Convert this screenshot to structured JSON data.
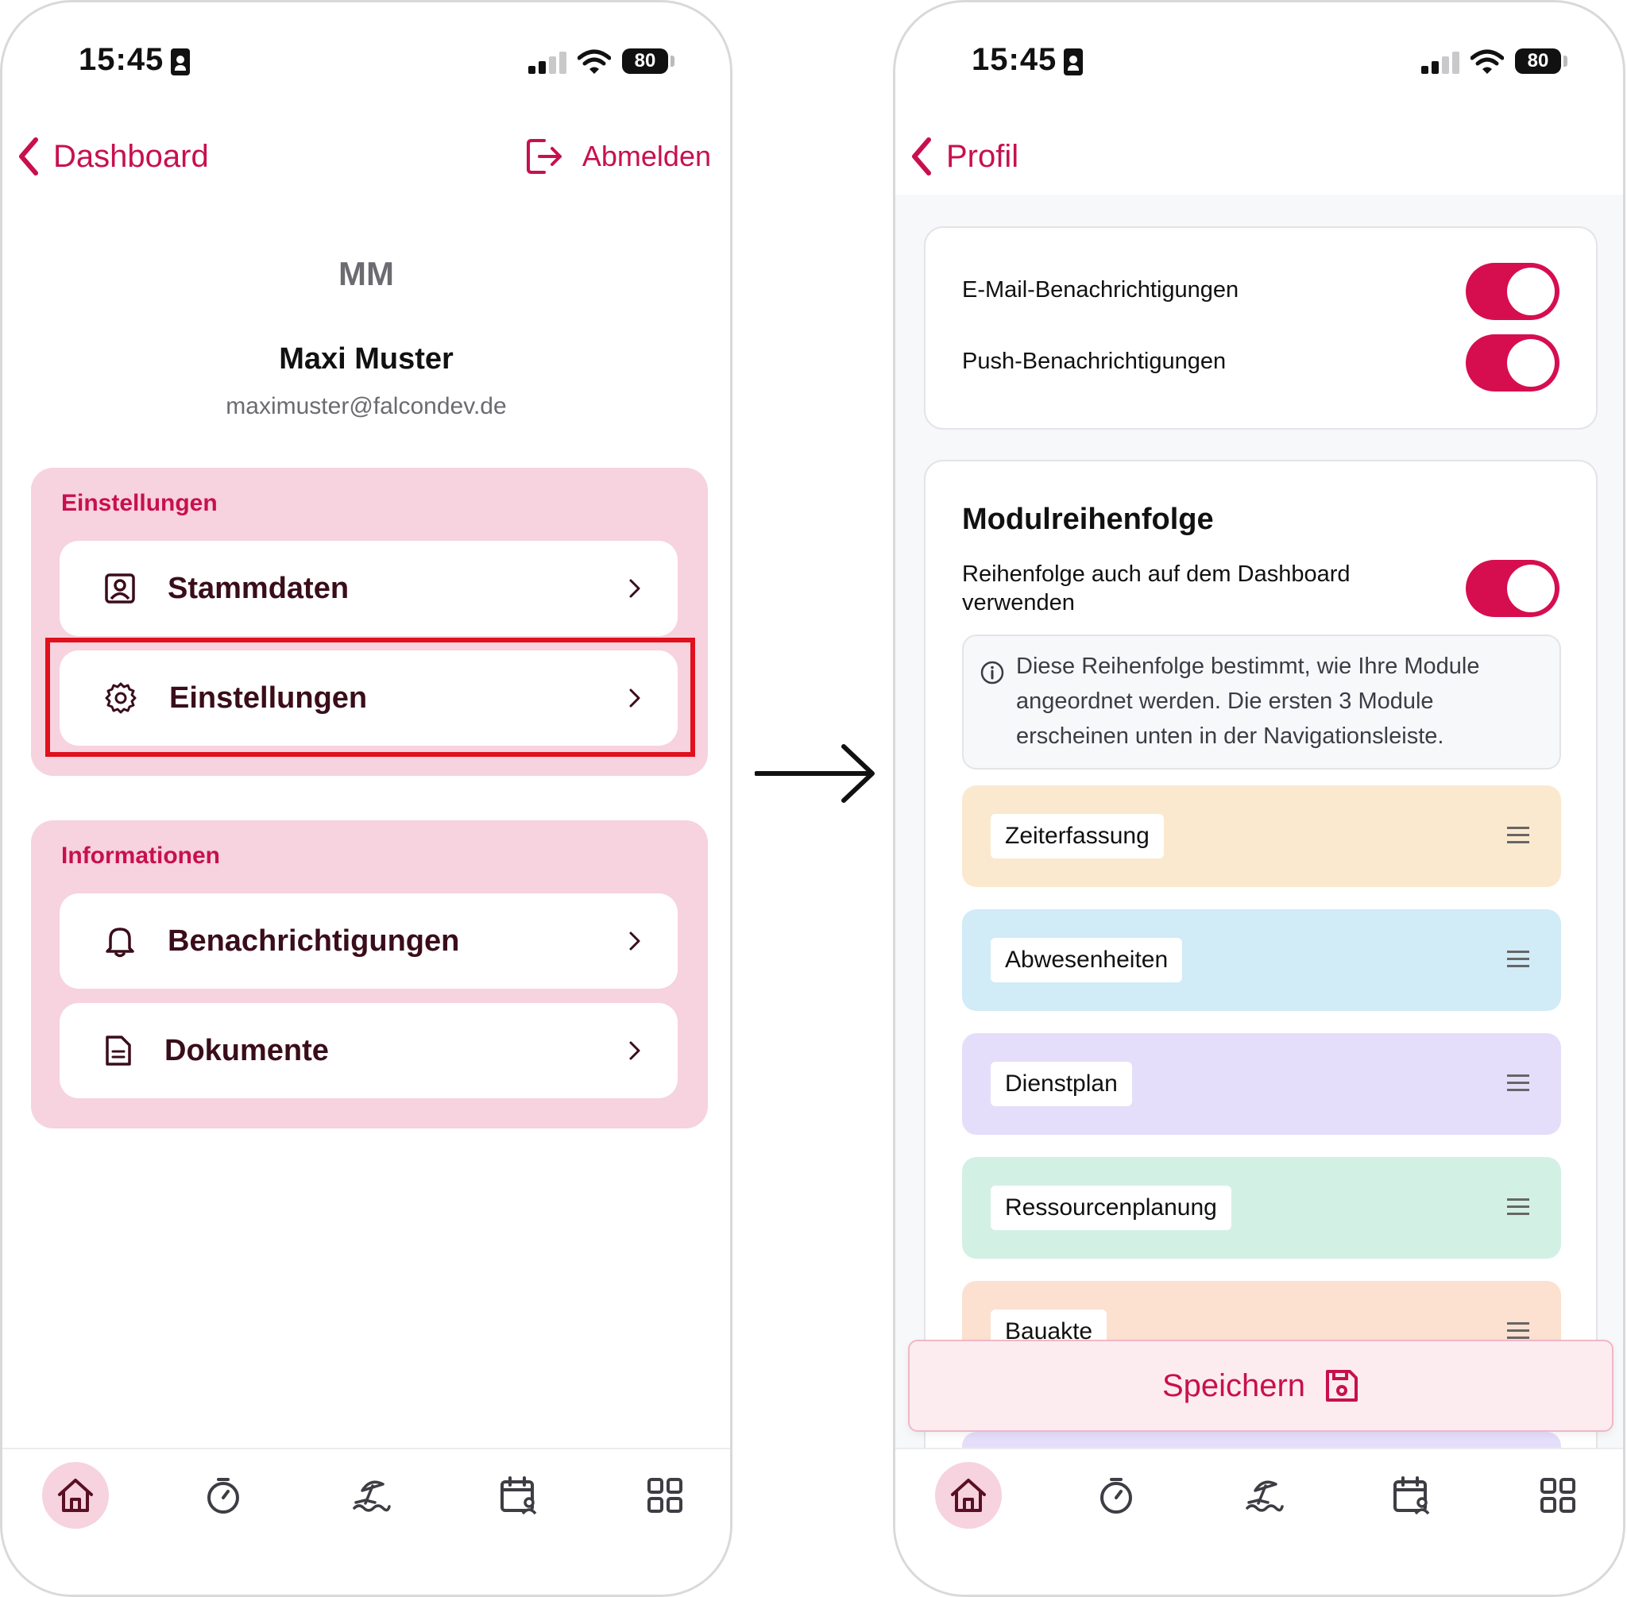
{
  "left": {
    "status": {
      "time": "15:45",
      "battery": "80"
    },
    "back_label": "Dashboard",
    "logout_label": "Abmelden",
    "profile": {
      "initials": "MM",
      "name": "Maxi Muster",
      "email": "maximuster@falcondev.de"
    },
    "settings_group": {
      "title": "Einstellungen",
      "items": [
        {
          "label": "Stammdaten",
          "icon": "contact-card-icon"
        },
        {
          "label": "Einstellungen",
          "icon": "gear-icon"
        }
      ]
    },
    "info_group": {
      "title": "Informationen",
      "items": [
        {
          "label": "Benachrichtigungen",
          "icon": "bell-icon"
        },
        {
          "label": "Dokumente",
          "icon": "document-icon"
        }
      ]
    },
    "tabs": [
      "home-icon",
      "stopwatch-icon",
      "beach-icon",
      "calendar-user-icon",
      "grid-icon"
    ]
  },
  "right": {
    "status": {
      "time": "15:45",
      "battery": "80"
    },
    "back_label": "Profil",
    "notifications": [
      {
        "label": "E-Mail-Benachrichtigungen",
        "on": true
      },
      {
        "label": "Push-Benachrichtigungen",
        "on": true
      }
    ],
    "module_order": {
      "title": "Modulreihenfolge",
      "dashboard_toggle_label": "Reihenfolge auch auf dem Dashboard verwenden",
      "dashboard_toggle_on": true,
      "info": "Diese Reihenfolge bestimmt, wie Ihre Module angeordnet werden. Die ersten 3 Module erscheinen unten in der Navigationsleiste.",
      "modules": [
        {
          "label": "Zeiterfassung",
          "color": "#fbe9cf"
        },
        {
          "label": "Abwesenheiten",
          "color": "#d1ebf7"
        },
        {
          "label": "Dienstplan",
          "color": "#e5defa"
        },
        {
          "label": "Ressourcenplanung",
          "color": "#d3f0e4"
        },
        {
          "label": "Bauakte",
          "color": "#fce0d0"
        }
      ]
    },
    "save_label": "Speichern",
    "tabs": [
      "home-icon",
      "stopwatch-icon",
      "beach-icon",
      "calendar-user-icon",
      "grid-icon"
    ]
  },
  "colors": {
    "accent": "#c8104e",
    "group_bg": "#f6d3de",
    "highlight": "#e0101e"
  }
}
